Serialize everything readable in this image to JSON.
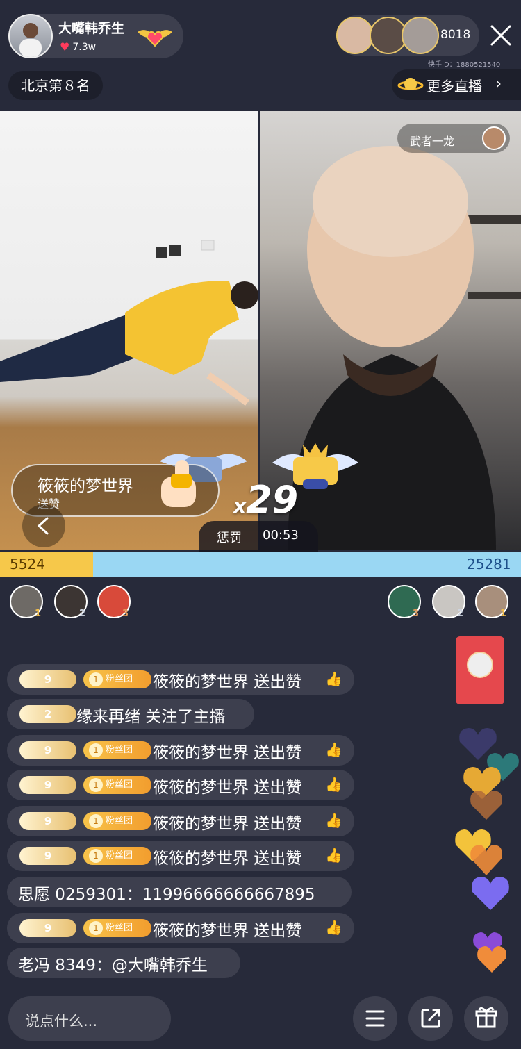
{
  "host": {
    "name": "大嘴韩乔生",
    "likes": "7.3w"
  },
  "viewers": {
    "count": "8018",
    "account_id": "快手ID：1880521540"
  },
  "rank": {
    "label": "北京第８名"
  },
  "more_live": {
    "label": "更多直播"
  },
  "opponent": {
    "name": "武者一龙"
  },
  "gift_notice": {
    "user": "筱筱的梦世界",
    "action": "送赞"
  },
  "battle": {
    "multiplier": "29",
    "multiplier_prefix": "x",
    "penalty_label": "惩罚",
    "timer": "00:53"
  },
  "score": {
    "left": "5524",
    "right": "25281",
    "left_fraction": 0.179
  },
  "contributors": {
    "left_ranks": [
      "1",
      "2",
      "3"
    ],
    "right_ranks": [
      "3",
      "2",
      "1"
    ]
  },
  "chat": [
    {
      "level": "9",
      "fan": "粉丝团",
      "fan_level": "1",
      "text": "筱筱的梦世界 送出赞"
    },
    {
      "level": "2",
      "text": "缘来再绪 关注了主播"
    },
    {
      "level": "9",
      "fan": "粉丝团",
      "fan_level": "1",
      "text": "筱筱的梦世界 送出赞"
    },
    {
      "level": "9",
      "fan": "粉丝团",
      "fan_level": "1",
      "text": "筱筱的梦世界 送出赞"
    },
    {
      "level": "9",
      "fan": "粉丝团",
      "fan_level": "1",
      "text": "筱筱的梦世界 送出赞"
    },
    {
      "level": "9",
      "fan": "粉丝团",
      "fan_level": "1",
      "text": "筱筱的梦世界 送出赞"
    },
    {
      "text": "思愿 0259301：11996666666667895"
    },
    {
      "level": "9",
      "fan": "粉丝团",
      "fan_level": "1",
      "text": "筱筱的梦世界 送出赞"
    },
    {
      "text": "老冯 8349：@大嘴韩乔生"
    }
  ],
  "input": {
    "placeholder": "说点什么..."
  },
  "colors": {
    "bg": "#272a3a",
    "score_left": "#f6c84a",
    "score_right": "#9ad7f3",
    "accent_gold": "#e8c071"
  },
  "icons": [
    "heart-icon",
    "close-icon",
    "planet-icon",
    "chevron-right-icon",
    "back-chevron-icon",
    "menu-icon",
    "share-icon",
    "gift-icon"
  ]
}
